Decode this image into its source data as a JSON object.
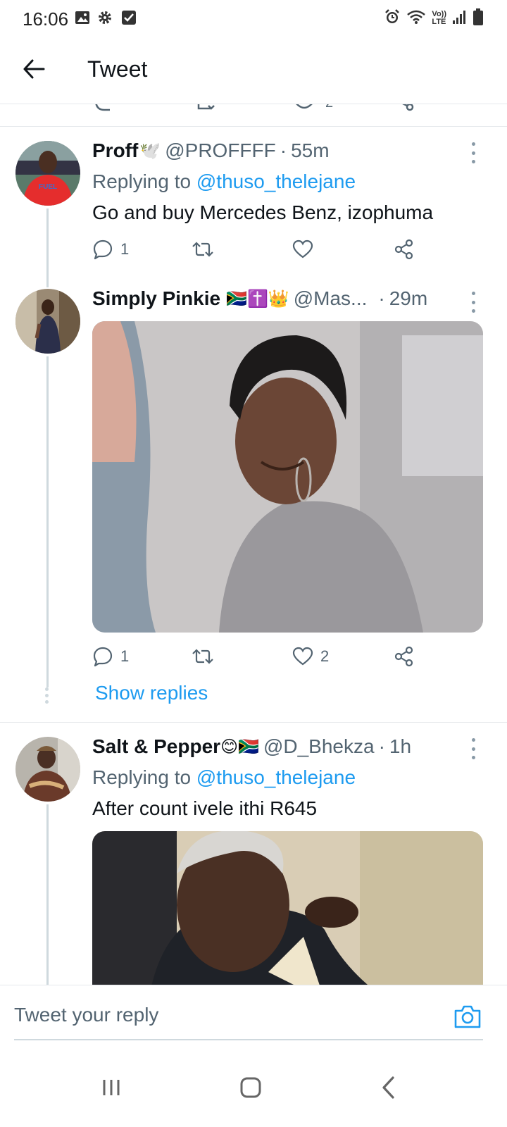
{
  "status_bar": {
    "time": "16:06",
    "icons_left": [
      "image-icon",
      "gear-icon",
      "checkbox-icon"
    ],
    "icons_right": [
      "alarm-icon",
      "wifi-icon",
      "volte-icon",
      "signal-icon",
      "battery-icon"
    ],
    "volte_text_top": "Vo))",
    "volte_text_bottom": "LTE"
  },
  "header": {
    "title": "Tweet"
  },
  "tweets": [
    {
      "display_name": "Proff",
      "emoji": "🕊️",
      "handle": "@PROFFFF",
      "time": "55m",
      "replying_label": "Replying to ",
      "replying_to": "@thuso_thelejane",
      "text": "Go and buy Mercedes Benz, izophuma",
      "reply_count": "1",
      "retweet_count": "",
      "like_count": ""
    },
    {
      "display_name": "Simply Pinkie",
      "emoji": "🇿🇦✝️👑",
      "handle": "@Mas...",
      "time": "29m",
      "reply_count": "1",
      "retweet_count": "",
      "like_count": "2",
      "show_replies": "Show replies"
    },
    {
      "display_name": "Salt & Pepper",
      "emoji": "😊🇿🇦",
      "handle": "@D_Bhekza",
      "time": "1h",
      "replying_label": "Replying to ",
      "replying_to": "@thuso_thelejane",
      "text": "After count ivele ithi R645"
    }
  ],
  "reply_bar": {
    "placeholder": "Tweet your reply"
  },
  "colors": {
    "accent": "#1d9bf0",
    "secondary_text": "#536471",
    "divider": "#e6e9ec"
  }
}
